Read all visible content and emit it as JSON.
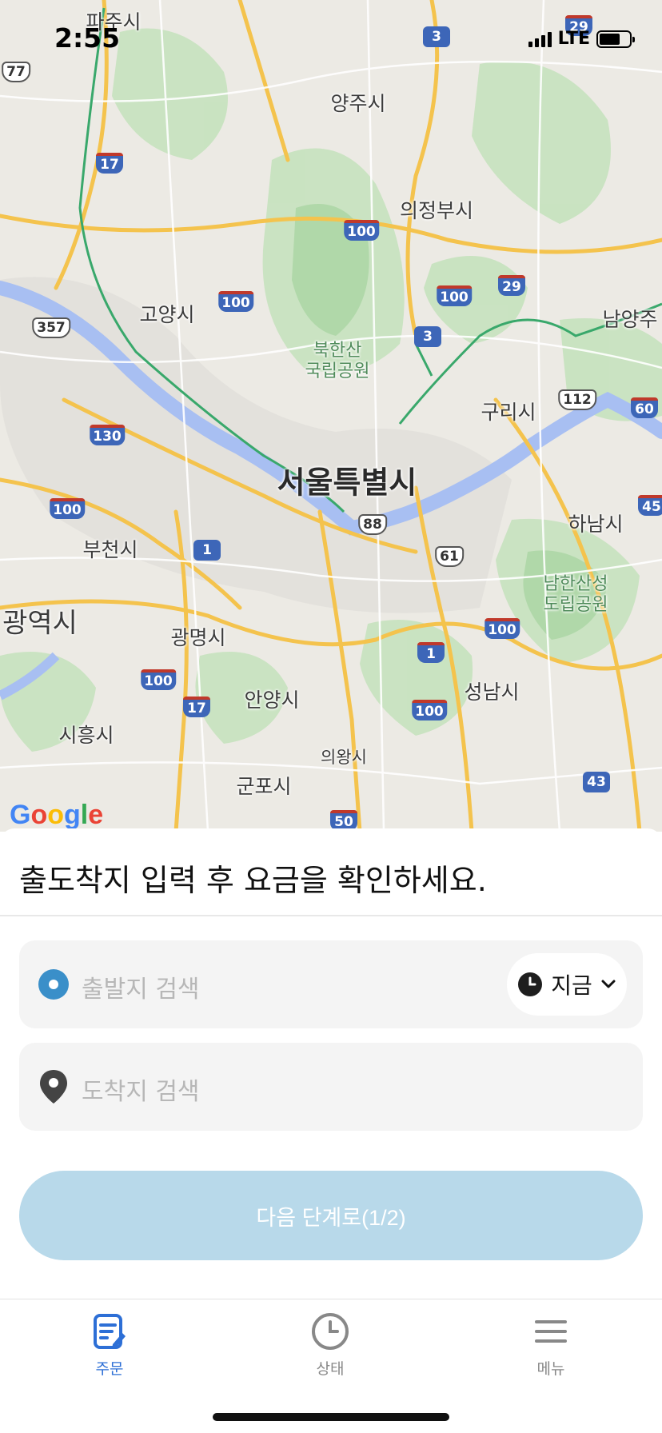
{
  "status_bar": {
    "time": "2:55",
    "network": "LTE"
  },
  "map": {
    "attribution": "Google",
    "cities": [
      {
        "name": "파주시"
      },
      {
        "name": "양주시"
      },
      {
        "name": "의정부시"
      },
      {
        "name": "고양시"
      },
      {
        "name": "남양주"
      },
      {
        "name": "구리시"
      },
      {
        "name": "서울특별시"
      },
      {
        "name": "하남시"
      },
      {
        "name": "부천시"
      },
      {
        "name": "광역시"
      },
      {
        "name": "광명시"
      },
      {
        "name": "안양시"
      },
      {
        "name": "성남시"
      },
      {
        "name": "시흥시"
      },
      {
        "name": "의왕시"
      },
      {
        "name": "군포시"
      }
    ],
    "parks": [
      {
        "name": "북한산\n국립공원"
      },
      {
        "name": "남한산성\n도립공원"
      }
    ],
    "road_shields": [
      "29",
      "3",
      "77",
      "17",
      "100",
      "29",
      "100",
      "357",
      "100",
      "3",
      "112",
      "60",
      "130",
      "100",
      "45",
      "88",
      "61",
      "1",
      "100",
      "1",
      "100",
      "17",
      "100",
      "43",
      "50"
    ]
  },
  "sheet": {
    "title": "출도착지 입력 후 요금을 확인하세요.",
    "origin_placeholder": "출발지 검색",
    "destination_placeholder": "도착지 검색",
    "time_selector": "지금",
    "next_button": "다음 단계로(1/2)"
  },
  "tabbar": {
    "items": [
      {
        "label": "주문",
        "icon": "order-icon",
        "active": true
      },
      {
        "label": "상태",
        "icon": "clock-icon",
        "active": false
      },
      {
        "label": "메뉴",
        "icon": "menu-icon",
        "active": false
      }
    ]
  },
  "colors": {
    "accent": "#2d6fd6",
    "origin_dot": "#3a8fc9",
    "button_disabled": "#b8d9ea",
    "river": "#a8bff2",
    "park": "#b7dcb3"
  }
}
